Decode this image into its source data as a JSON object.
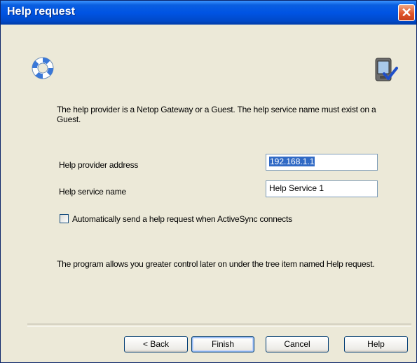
{
  "window": {
    "title": "Help request",
    "close_glyph": "✕"
  },
  "icons": {
    "left": "lifebuoy-icon",
    "right": "device-check-icon"
  },
  "intro_text": "The help provider is a Netop Gateway or a Guest. The help service name must exist on a Guest.",
  "fields": {
    "address_label": "Help provider address",
    "address_value": "192.168.1.1",
    "service_label": "Help service name",
    "service_value": "Help Service 1"
  },
  "checkbox": {
    "label": "Automatically send a help request when ActiveSync connects",
    "checked": false
  },
  "outro_text": "The program allows you greater control later on under the tree item named Help request.",
  "buttons": {
    "back": "< Back",
    "finish": "Finish",
    "cancel": "Cancel",
    "help": "Help"
  },
  "colors": {
    "titlebar": "#0054E3",
    "background": "#ECE9D8",
    "close": "#E0552A",
    "selection": "#316AC5"
  }
}
